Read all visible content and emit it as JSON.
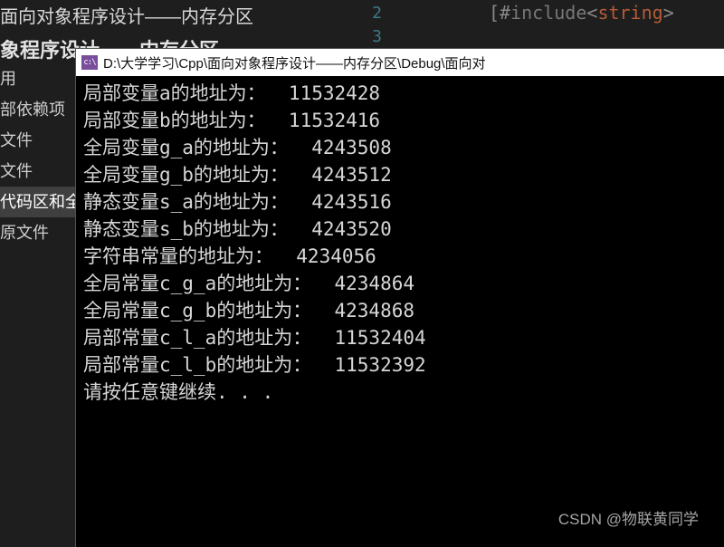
{
  "ide": {
    "title": "面向对象程序设计——内存分区",
    "subtitle": "象程序设计——内存分区",
    "line_numbers": [
      "2",
      "3"
    ],
    "code_snippet": {
      "prefix": "[",
      "hash": "#",
      "keyword": "include",
      "open": "<",
      "str": "string",
      "close": ">"
    },
    "tree_items": [
      {
        "label": "用"
      },
      {
        "label": "部依赖项"
      },
      {
        "label": "文件"
      },
      {
        "label": "文件"
      },
      {
        "label": "代码区和全",
        "selected": true
      },
      {
        "label": "原文件"
      }
    ]
  },
  "console": {
    "icon_text": "c:\\",
    "title": "D:\\大学学习\\Cpp\\面向对象程序设计——内存分区\\Debug\\面向对",
    "lines": [
      "局部变量a的地址为：  11532428",
      "局部变量b的地址为：  11532416",
      "全局变量g_a的地址为：  4243508",
      "全局变量g_b的地址为：  4243512",
      "静态变量s_a的地址为：  4243516",
      "静态变量s_b的地址为：  4243520",
      "字符串常量的地址为：  4234056",
      "全局常量c_g_a的地址为：  4234864",
      "全局常量c_g_b的地址为：  4234868",
      "局部常量c_l_a的地址为：  11532404",
      "局部常量c_l_b的地址为：  11532392",
      "请按任意键继续. . ."
    ]
  },
  "watermark": "CSDN @物联黄同学"
}
